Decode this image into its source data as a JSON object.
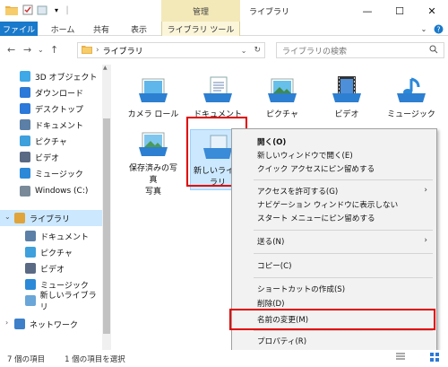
{
  "titlebar": {
    "manage_tab": "管理",
    "window_title": "ライブラリ",
    "minimize": "—",
    "maximize": "☐",
    "close": "✕"
  },
  "ribbon": {
    "tabs": [
      "ファイル",
      "ホーム",
      "共有",
      "表示"
    ],
    "context_tab": "ライブラリ ツール"
  },
  "address": {
    "breadcrumb": "ライブラリ",
    "search_placeholder": "ライブラリの検索"
  },
  "nav": {
    "items": [
      {
        "label": "3D オブジェクト",
        "icon": "cube-icon",
        "color": "#3fa8e6"
      },
      {
        "label": "ダウンロード",
        "icon": "download-icon",
        "color": "#2b79d8"
      },
      {
        "label": "デスクトップ",
        "icon": "desktop-icon",
        "color": "#2b79d8"
      },
      {
        "label": "ドキュメント",
        "icon": "document-icon",
        "color": "#5b7fa6"
      },
      {
        "label": "ピクチャ",
        "icon": "picture-icon",
        "color": "#3ea0dc"
      },
      {
        "label": "ビデオ",
        "icon": "video-icon",
        "color": "#5a6a84"
      },
      {
        "label": "ミュージック",
        "icon": "music-icon",
        "color": "#2b89d8"
      },
      {
        "label": "Windows (C:)",
        "icon": "drive-icon",
        "color": "#7a8a99"
      },
      {
        "label": "ライブラリ",
        "icon": "library-icon",
        "color": "#e0a43a"
      },
      {
        "label": "ドキュメント",
        "icon": "document-icon",
        "color": "#5b7fa6"
      },
      {
        "label": "ピクチャ",
        "icon": "picture-icon",
        "color": "#3ea0dc"
      },
      {
        "label": "ビデオ",
        "icon": "video-icon",
        "color": "#5a6a84"
      },
      {
        "label": "ミュージック",
        "icon": "music-icon",
        "color": "#2b89d8"
      },
      {
        "label": "新しいライブラリ",
        "icon": "library-icon",
        "color": "#6aa6d8"
      },
      {
        "label": "ネットワーク",
        "icon": "network-icon",
        "color": "#3d7fc8"
      }
    ]
  },
  "content": {
    "items": [
      {
        "label": "カメラ ロール",
        "icon": "camera-roll-icon"
      },
      {
        "label": "ドキュメント",
        "icon": "documents-library-icon"
      },
      {
        "label": "ピクチャ",
        "icon": "pictures-library-icon"
      },
      {
        "label": "ビデオ",
        "icon": "videos-library-icon"
      },
      {
        "label": "ミュージック",
        "icon": "music-library-icon"
      },
      {
        "label": "保存済みの写真",
        "label2": "写真",
        "icon": "saved-pictures-icon"
      },
      {
        "label": "新しいライブ",
        "label2": "ラリ",
        "icon": "new-library-icon"
      }
    ]
  },
  "menu": {
    "open": "開く(O)",
    "open_new_window": "新しいウィンドウで開く(E)",
    "pin_quick_access": "クイック アクセスにピン留めする",
    "give_access": "アクセスを許可する(G)",
    "hide_nav": "ナビゲーション ウィンドウに表示しない",
    "pin_start": "スタート メニューにピン留めする",
    "send_to": "送る(N)",
    "copy": "コピー(C)",
    "create_shortcut": "ショートカットの作成(S)",
    "delete": "削除(D)",
    "rename": "名前の変更(M)",
    "properties": "プロパティ(R)"
  },
  "status": {
    "item_count": "7 個の項目",
    "selected": "1 個の項目を選択"
  },
  "colors": {
    "accent": "#1979ca",
    "highlight": "#e10000",
    "manage_tab": "#f3e9b8"
  }
}
